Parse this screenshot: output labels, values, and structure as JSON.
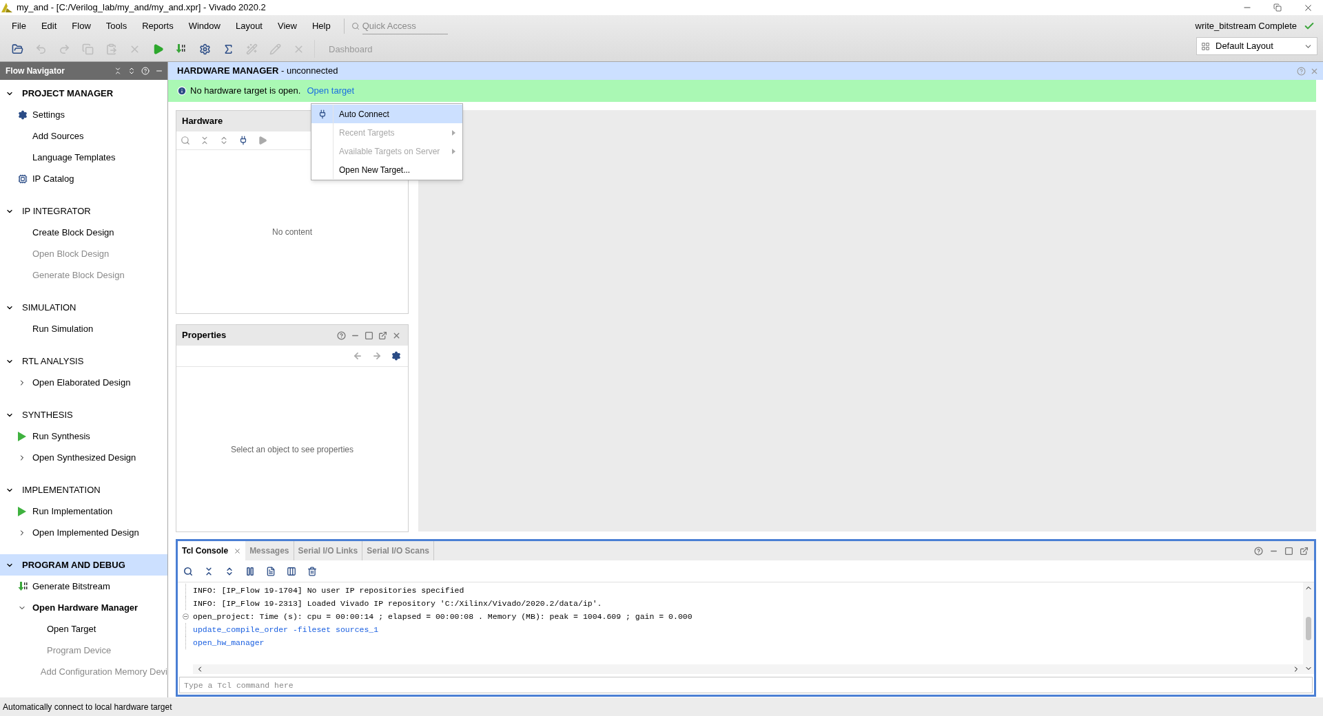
{
  "window": {
    "title": "my_and - [C:/Verilog_lab/my_and/my_and.xpr] - Vivado 2020.2"
  },
  "menu_bar": [
    "File",
    "Edit",
    "Flow",
    "Tools",
    "Reports",
    "Window",
    "Layout",
    "View",
    "Help"
  ],
  "quick_access": {
    "placeholder": "Quick Access"
  },
  "toolbar": [
    {
      "kind": "open",
      "disabled": false
    },
    {
      "kind": "undo",
      "disabled": true
    },
    {
      "kind": "redo",
      "disabled": true
    },
    {
      "kind": "copy",
      "disabled": true
    },
    {
      "kind": "paste",
      "disabled": true
    },
    {
      "kind": "delete",
      "disabled": true
    },
    {
      "kind": "run",
      "disabled": false
    },
    {
      "kind": "bitstream",
      "disabled": false
    },
    {
      "kind": "settings",
      "disabled": false
    },
    {
      "kind": "report",
      "disabled": false
    },
    {
      "kind": "wand",
      "disabled": true
    },
    {
      "kind": "pencil",
      "disabled": true
    },
    {
      "kind": "cross",
      "disabled": true
    }
  ],
  "dashboard": {
    "label": "Dashboard",
    "disabled": true
  },
  "status": "write_bitstream Complete",
  "layout_select": {
    "value": "Default Layout"
  },
  "flow_navigator": {
    "title": "Flow Navigator",
    "sections": [
      {
        "label": "PROJECT MANAGER",
        "bold": true,
        "selected": false,
        "items": [
          {
            "label": "Settings",
            "kind": "gear",
            "disabled": false
          },
          {
            "label": "Add Sources",
            "disabled": false
          },
          {
            "label": "Language Templates",
            "disabled": false
          },
          {
            "label": "IP Catalog",
            "kind": "ip",
            "disabled": false
          }
        ]
      },
      {
        "label": "IP INTEGRATOR",
        "bold": false,
        "selected": false,
        "items": [
          {
            "label": "Create Block Design",
            "disabled": false
          },
          {
            "label": "Open Block Design",
            "disabled": true
          },
          {
            "label": "Generate Block Design",
            "disabled": true
          }
        ]
      },
      {
        "label": "SIMULATION",
        "bold": false,
        "selected": false,
        "items": [
          {
            "label": "Run Simulation",
            "disabled": false
          }
        ]
      },
      {
        "label": "RTL ANALYSIS",
        "bold": false,
        "selected": false,
        "items": [
          {
            "label": "Open Elaborated Design",
            "disabled": false,
            "expanded": false
          }
        ]
      },
      {
        "label": "SYNTHESIS",
        "bold": false,
        "selected": false,
        "items": [
          {
            "label": "Run Synthesis",
            "kind": "play",
            "disabled": false
          },
          {
            "label": "Open Synthesized Design",
            "disabled": false,
            "expanded": false
          }
        ]
      },
      {
        "label": "IMPLEMENTATION",
        "bold": false,
        "selected": false,
        "items": [
          {
            "label": "Run Implementation",
            "kind": "play",
            "disabled": false
          },
          {
            "label": "Open Implemented Design",
            "disabled": false,
            "expanded": false
          }
        ]
      },
      {
        "label": "PROGRAM AND DEBUG",
        "bold": true,
        "selected": true,
        "items": [
          {
            "label": "Generate Bitstream",
            "kind": "bitstream",
            "disabled": false
          },
          {
            "label": "Open Hardware Manager",
            "disabled": false,
            "bold": true,
            "expanded": true,
            "children": [
              {
                "label": "Open Target",
                "disabled": false
              },
              {
                "label": "Program Device",
                "disabled": true
              },
              {
                "label": "Add Configuration Memory Devi",
                "disabled": true
              }
            ]
          }
        ]
      }
    ]
  },
  "hardware_manager": {
    "title": "HARDWARE MANAGER",
    "subtitle": "- unconnected"
  },
  "banner": {
    "message": "No hardware target is open.",
    "link": "Open target"
  },
  "hardware_panel": {
    "title": "Hardware",
    "empty_text": "No content"
  },
  "properties_panel": {
    "title": "Properties",
    "empty_text": "Select an object to see properties"
  },
  "context_menu": [
    {
      "label": "Auto Connect",
      "kind": "connect",
      "selected": true,
      "disabled": false,
      "submenu": false
    },
    {
      "label": "Recent Targets",
      "selected": false,
      "disabled": true,
      "submenu": true
    },
    {
      "label": "Available Targets on Server",
      "selected": false,
      "disabled": true,
      "submenu": true
    },
    {
      "label": "Open New Target...",
      "selected": false,
      "disabled": false,
      "submenu": false
    }
  ],
  "console": {
    "tabs": [
      {
        "label": "Tcl Console",
        "selected": true,
        "closable": true
      },
      {
        "label": "Messages",
        "selected": false,
        "closable": false
      },
      {
        "label": "Serial I/O Links",
        "selected": false,
        "closable": false
      },
      {
        "label": "Serial I/O Scans",
        "selected": false,
        "closable": false
      }
    ],
    "lines": [
      {
        "text": "INFO: [IP_Flow 19-1704] No user IP repositories specified",
        "kind": "output",
        "fold": false
      },
      {
        "text": "INFO: [IP_Flow 19-2313] Loaded Vivado IP repository 'C:/Xilinx/Vivado/2020.2/data/ip'.",
        "kind": "output",
        "fold": false
      },
      {
        "text": "open_project: Time (s): cpu = 00:00:14 ; elapsed = 00:00:08 . Memory (MB): peak = 1004.609 ; gain = 0.000",
        "kind": "output",
        "fold": true
      },
      {
        "text": "update_compile_order -fileset sources_1",
        "kind": "command",
        "fold": false
      },
      {
        "text": "open_hw_manager",
        "kind": "command",
        "fold": false
      }
    ],
    "input": {
      "placeholder": "Type a Tcl command here"
    }
  },
  "status_bar": "Automatically connect to local hardware target"
}
